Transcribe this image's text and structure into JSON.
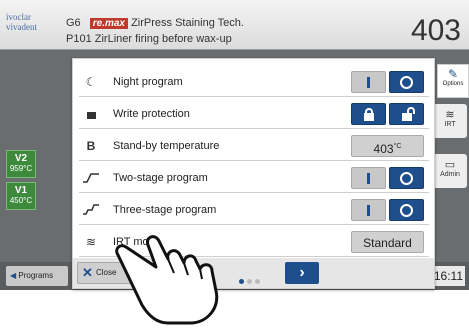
{
  "header": {
    "logo_line1": "ivoclar",
    "logo_line2": "vivadent",
    "device": "G6",
    "brand": "re.max",
    "product": "ZirPress Staining Tech.",
    "program": "P101 ZirLiner firing before wax-up",
    "temperature": "403"
  },
  "side_left": {
    "tiles": [
      {
        "label": "V2",
        "temp": "959°C"
      },
      {
        "label": "V1",
        "temp": "450°C"
      }
    ]
  },
  "side_right": {
    "options_label": "Options",
    "irt_label": "IRT",
    "admin_label": "Admin"
  },
  "bottom_bar": {
    "programs_label": "Programs",
    "time": ":16:11"
  },
  "dialog": {
    "rows": [
      {
        "icon": "moon-icon",
        "label": "Night program"
      },
      {
        "icon": "lock-icon",
        "label": "Write protection"
      },
      {
        "icon": "b-letter-icon",
        "label": "Stand-by temperature",
        "icon_text": "B",
        "value": "403",
        "unit": "°C"
      },
      {
        "icon": "two-stage-icon",
        "label": "Two-stage program"
      },
      {
        "icon": "three-stage-icon",
        "label": "Three-stage program"
      },
      {
        "icon": "irt-icon",
        "label": "IRT mode",
        "value": "Standard"
      }
    ],
    "close_label": "Close",
    "toggle_on_glyph": "I",
    "colors": {
      "accent": "#1f4e8c",
      "brand_red": "#c0392b",
      "tile_green": "#3d8a3d"
    }
  }
}
